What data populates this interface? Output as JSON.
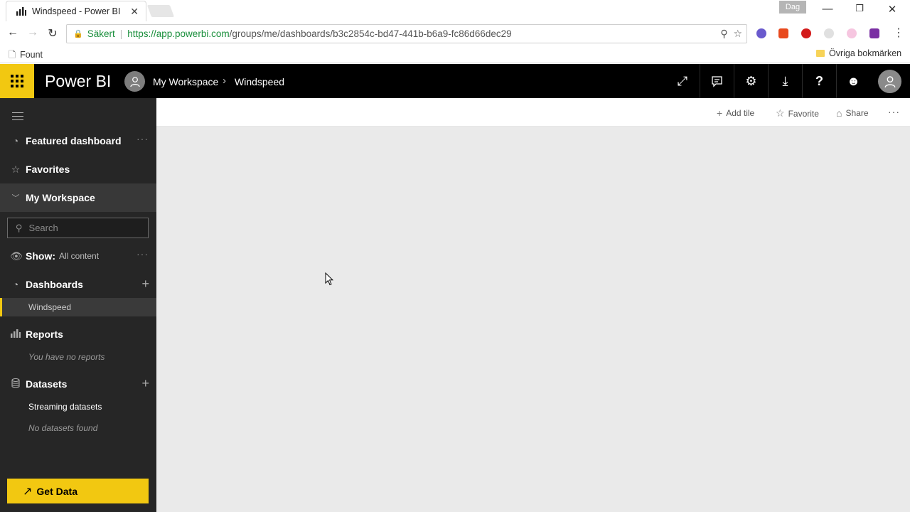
{
  "browser": {
    "tab_title": "Windspeed - Power BI",
    "profile": "Dag",
    "secure_label": "Säkert",
    "url_host": "https://app.powerbi.com",
    "url_path": "/groups/me/dashboards/b3c2854c-bd47-441b-b6a9-fc86d66dec29",
    "bookmark_left": "Fount",
    "bookmark_right": "Övriga bokmärken"
  },
  "header": {
    "brand": "Power BI",
    "workspace": "My Workspace",
    "dashboard": "Windspeed"
  },
  "sidebar": {
    "featured": "Featured dashboard",
    "favorites": "Favorites",
    "workspace": "My Workspace",
    "search_placeholder": "Search",
    "show_label": "Show:",
    "show_value": "All content",
    "dashboards": "Dashboards",
    "dashboard_items": [
      "Windspeed"
    ],
    "reports": "Reports",
    "reports_empty": "You have no reports",
    "datasets": "Datasets",
    "streaming": "Streaming datasets",
    "datasets_empty": "No datasets found",
    "get_data": "Get Data"
  },
  "actions": {
    "add_tile": "Add tile",
    "favorite": "Favorite",
    "share": "Share"
  },
  "colors": {
    "accent": "#f2c811",
    "header_bg": "#000000",
    "sidebar_bg": "#262626",
    "canvas_bg": "#eaeaea"
  }
}
